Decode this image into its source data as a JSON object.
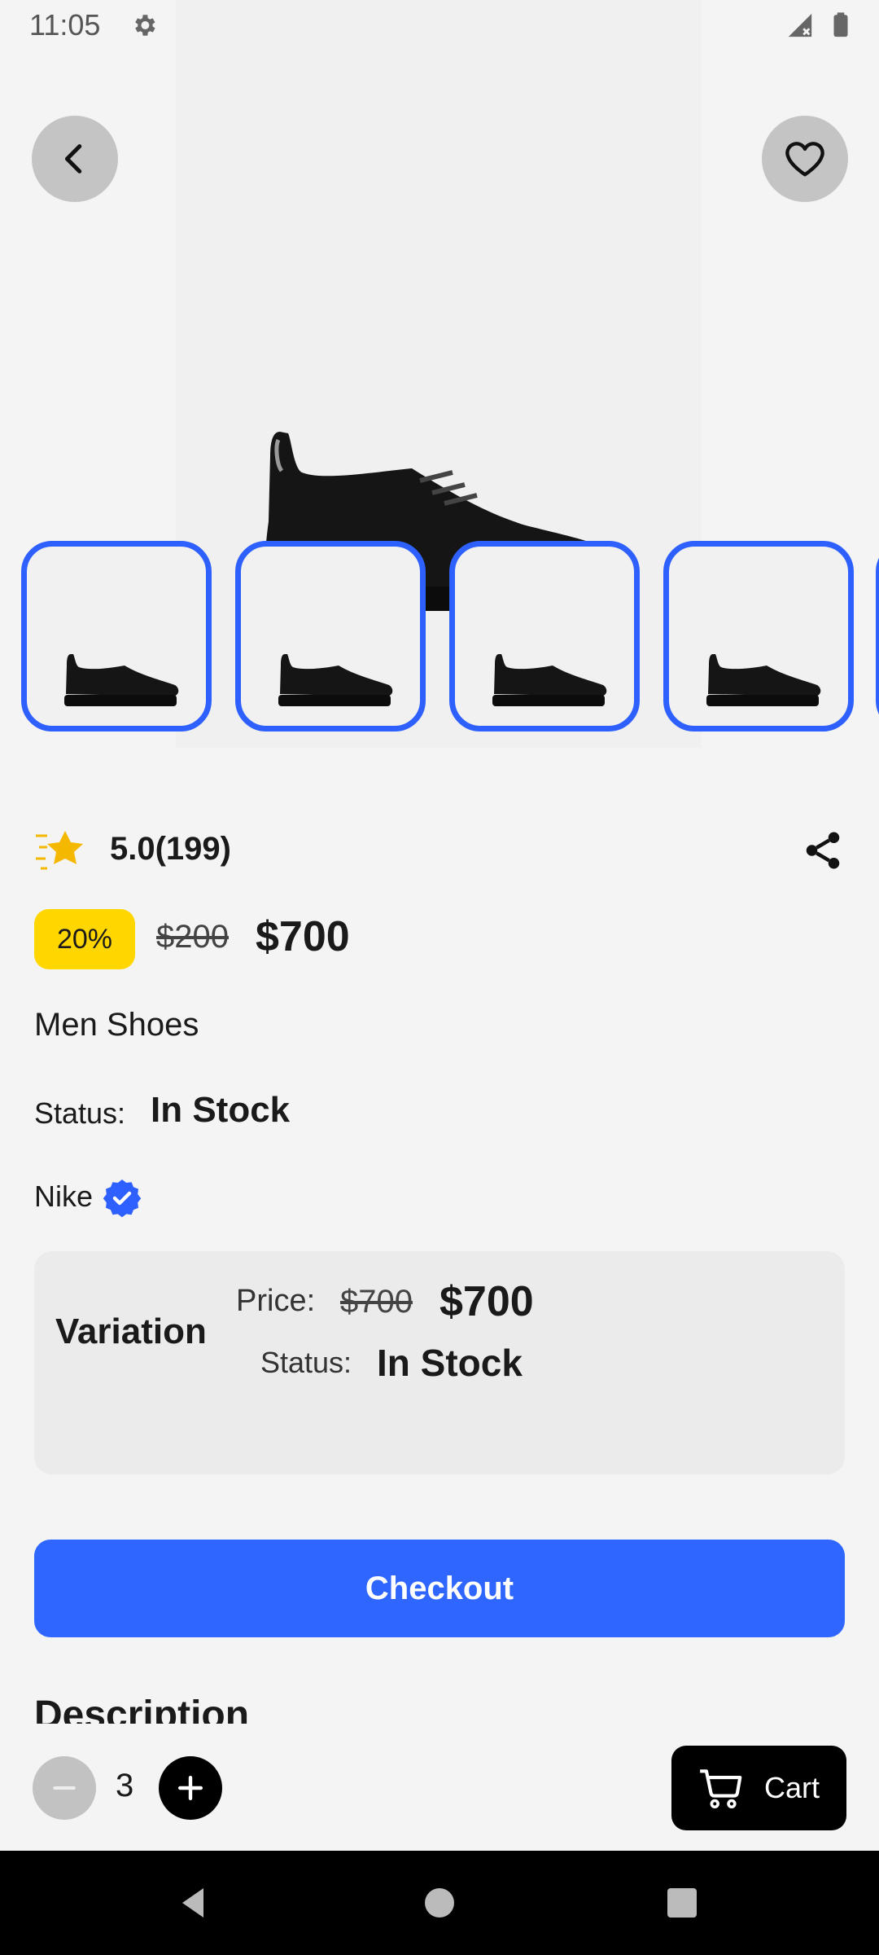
{
  "status_bar": {
    "time": "11:05",
    "icons": [
      "settings-icon",
      "settings-icon",
      "shield-icon",
      "sd-card-icon",
      "signal-icon",
      "battery-icon"
    ]
  },
  "header": {
    "back_icon": "chevron-left-icon",
    "favorite_icon": "heart-outline-icon"
  },
  "gallery": {
    "thumbnail_count": 4,
    "thumbnail_border_color": "#2e5fff"
  },
  "rating": {
    "text": "5.0(199)",
    "star_color": "#f5b800"
  },
  "price": {
    "discount": "20%",
    "old": "$200",
    "current": "$700"
  },
  "product": {
    "name": "Men Shoes",
    "status_label": "Status:",
    "status_value": "In Stock",
    "brand": "Nike"
  },
  "variation": {
    "title": "Variation",
    "price_label": "Price:",
    "old_price": "$700",
    "new_price": "$700",
    "status_label": "Status:",
    "status_value": "In Stock"
  },
  "checkout_label": "Checkout",
  "description_heading": "Description",
  "bottom_bar": {
    "quantity": "3",
    "cart_label": "Cart"
  },
  "colors": {
    "accent": "#2f66ff",
    "badge": "#ffd600"
  }
}
